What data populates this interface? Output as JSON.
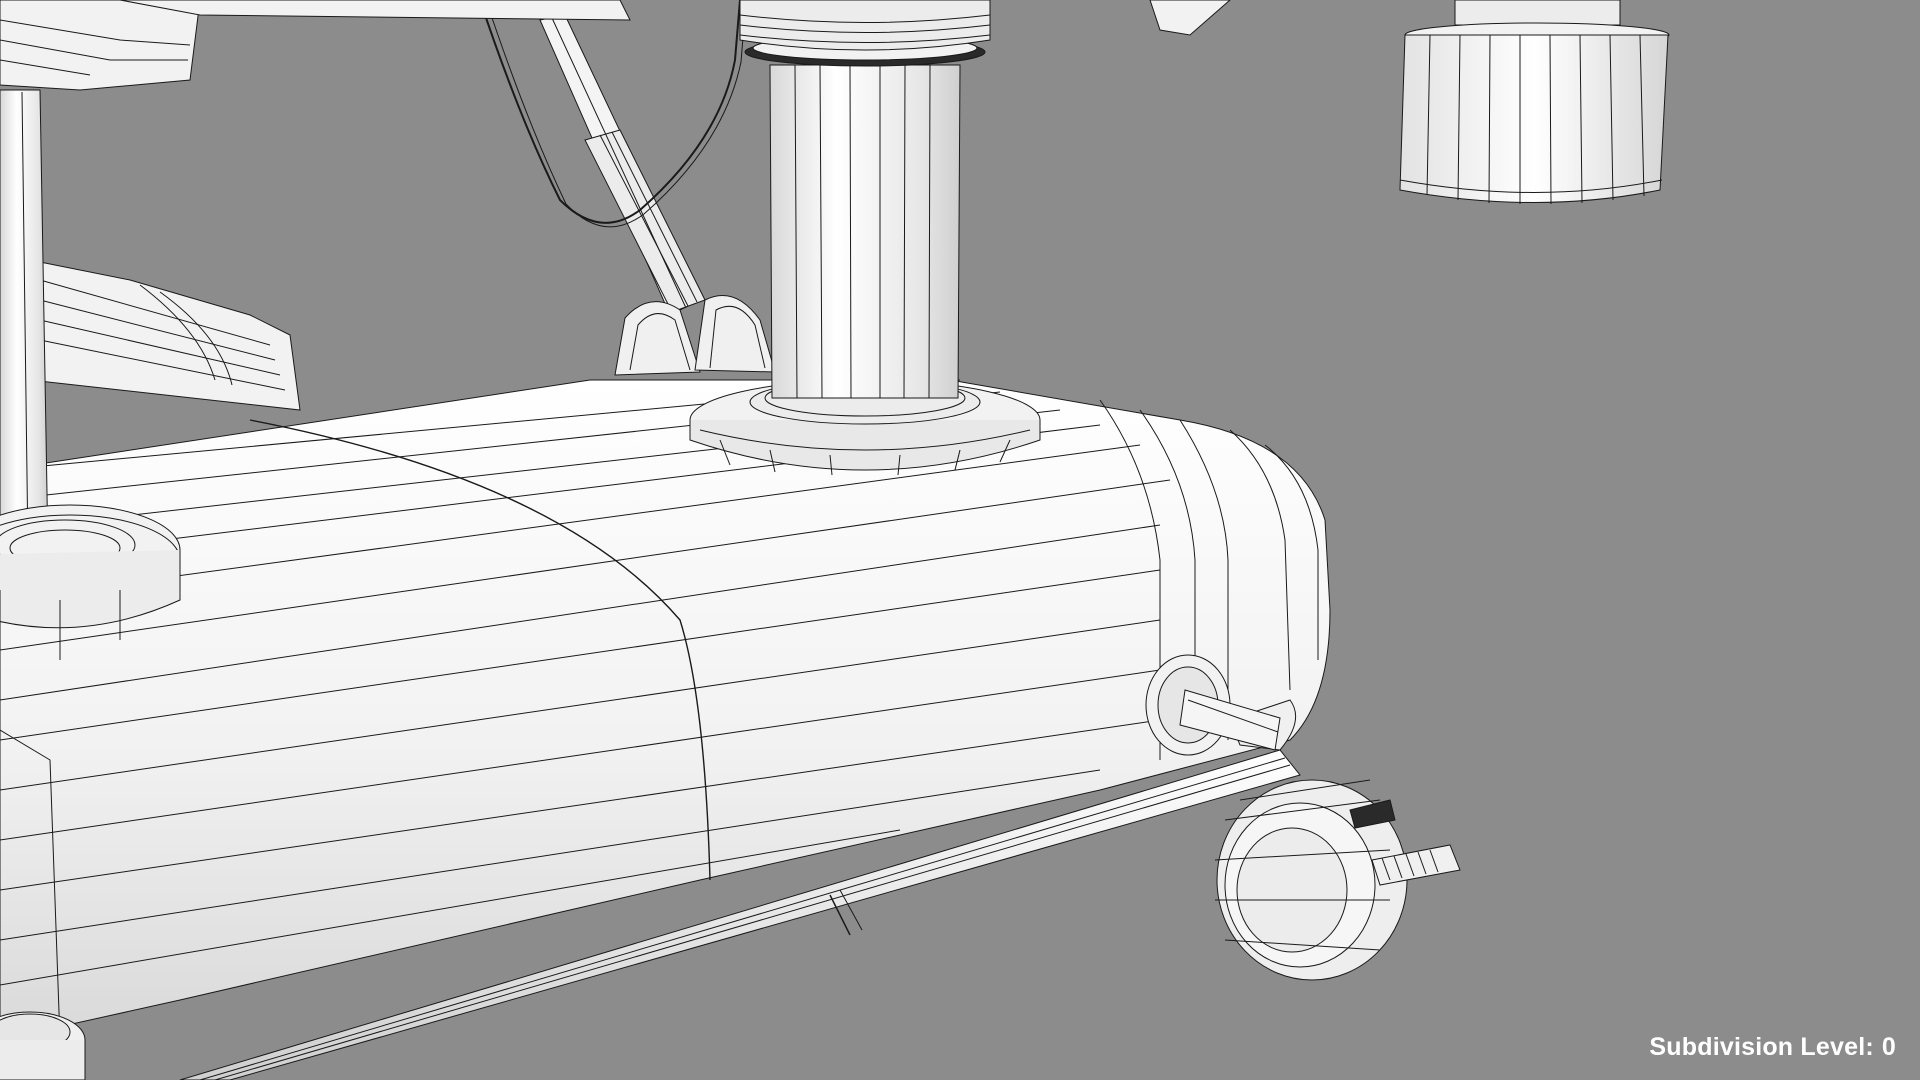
{
  "viewport": {
    "background": "#8c8c8c",
    "model_fill": "#f4f4f4",
    "wire_color": "#1a1a1a"
  },
  "overlay": {
    "label": "Subdivision Level:",
    "value": "0"
  }
}
